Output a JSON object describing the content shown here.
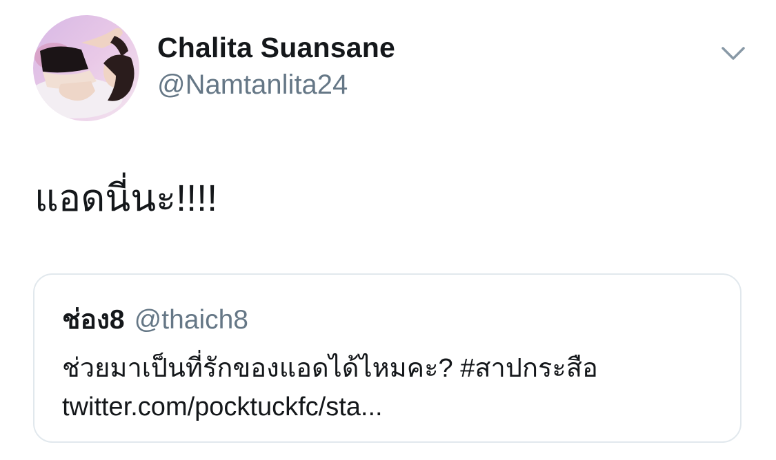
{
  "tweet": {
    "author": {
      "display_name": "Chalita Suansane",
      "handle": "@Namtanlita24",
      "avatar_icon": "profile-photo"
    },
    "menu_icon": "chevron-down-icon",
    "text": "แอดนี่นะ!!!!",
    "quoted_tweet": {
      "author_name": "ช่อง8",
      "author_handle": "@thaich8",
      "text_line1": "ช่วยมาเป็นที่รักของแอดได้ไหมคะ? #สาปกระสือ",
      "text_line2": "twitter.com/pocktuckfc/sta..."
    }
  },
  "colors": {
    "primary_text": "#14171a",
    "secondary_text": "#657786",
    "border": "#e1e8ed",
    "background": "#ffffff"
  }
}
